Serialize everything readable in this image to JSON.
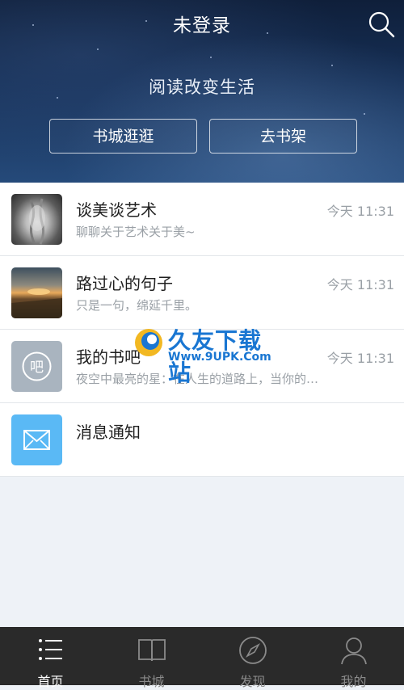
{
  "header": {
    "title": "未登录",
    "slogan": "阅读改变生活",
    "buttons": {
      "store": "书城逛逛",
      "shelf": "去书架"
    }
  },
  "messages": [
    {
      "title": "谈美谈艺术",
      "time": "今天 11:31",
      "preview": "聊聊关于艺术关于美~",
      "icon": "art-photo"
    },
    {
      "title": "路过心的句子",
      "time": "今天 11:31",
      "preview": "只是一句，绵延千里。",
      "icon": "sunset-photo"
    },
    {
      "title": "我的书吧",
      "time": "今天 11:31",
      "preview": "夜空中最亮的星：在人生的道路上，当你的…",
      "icon": "book-bar-icon",
      "icon_text": "吧"
    },
    {
      "title": "消息通知",
      "icon": "mail-icon"
    }
  ],
  "watermark": {
    "name": "久友下载站",
    "url": "Www.9UPK.Com"
  },
  "tabs": [
    {
      "label": "首页",
      "icon": "list-icon",
      "active": true
    },
    {
      "label": "书城",
      "icon": "book-icon",
      "active": false
    },
    {
      "label": "发现",
      "icon": "compass-icon",
      "active": false
    },
    {
      "label": "我的",
      "icon": "user-icon",
      "active": false
    }
  ],
  "colors": {
    "accent_blue": "#5ab9f5",
    "book_bar_gray": "#a9b4bf",
    "tabbar_bg": "#2a2a2a"
  }
}
